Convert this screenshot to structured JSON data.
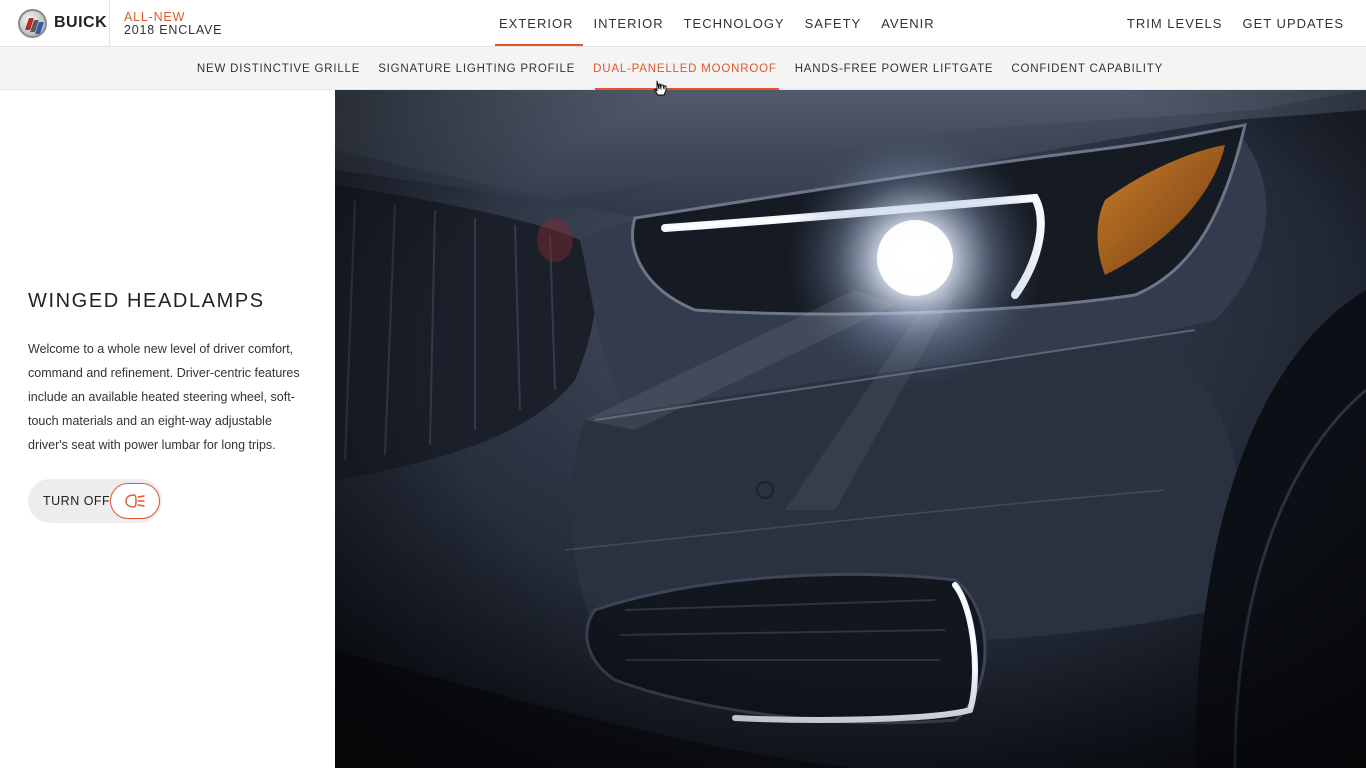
{
  "brand": {
    "name": "BUICK",
    "model_line1": "ALL-NEW",
    "model_line2": "2018 ENCLAVE"
  },
  "main_nav": [
    {
      "label": "EXTERIOR",
      "active": true
    },
    {
      "label": "INTERIOR",
      "active": false
    },
    {
      "label": "TECHNOLOGY",
      "active": false
    },
    {
      "label": "SAFETY",
      "active": false
    },
    {
      "label": "AVENIR",
      "active": false
    }
  ],
  "right_nav": [
    {
      "label": "TRIM LEVELS"
    },
    {
      "label": "GET UPDATES"
    }
  ],
  "sub_nav": [
    {
      "label": "NEW DISTINCTIVE GRILLE",
      "active": false
    },
    {
      "label": "SIGNATURE LIGHTING PROFILE",
      "active": false
    },
    {
      "label": "DUAL-PANELLED MOONROOF",
      "active": true
    },
    {
      "label": "HANDS-FREE POWER LIFTGATE",
      "active": false
    },
    {
      "label": "CONFIDENT CAPABILITY",
      "active": false
    }
  ],
  "feature": {
    "title": "WINGED HEADLAMPS",
    "description": "Welcome to a whole new level of driver comfort, command and refinement. Driver-centric features include an available heated steering wheel, soft-touch materials and an eight-way adjustable driver's seat with power lumbar for long trips.",
    "toggle_label": "TURN OFF",
    "toggle_icon": "headlamp-icon"
  },
  "colors": {
    "accent": "#e0582a",
    "subnav_bg": "#f4f4f4",
    "toggle_bg": "#ededed"
  }
}
